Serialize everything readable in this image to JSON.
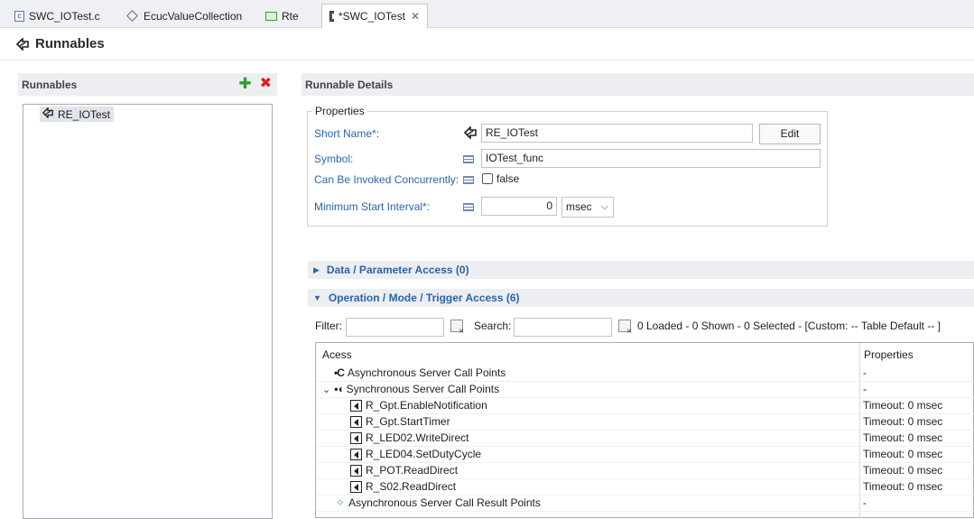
{
  "tabs": [
    {
      "label": "SWC_IOTest.c",
      "icon": "c-file-icon"
    },
    {
      "label": "EcucValueCollection",
      "icon": "ecuc-icon"
    },
    {
      "label": "Rte",
      "icon": "rte-icon"
    },
    {
      "label": "*SWC_IOTest",
      "icon": "swc-icon",
      "active": true
    }
  ],
  "page": {
    "title": "Runnables"
  },
  "left": {
    "heading": "Runnables",
    "items": [
      "RE_IOTest"
    ]
  },
  "details": {
    "heading": "Runnable Details",
    "properties_legend": "Properties",
    "short_name_label": "Short Name*:",
    "short_name_value": "RE_IOTest",
    "edit_label": "Edit",
    "symbol_label": "Symbol:",
    "symbol_value": "IOTest_func",
    "concurrent_label": "Can Be Invoked Concurrently:",
    "concurrent_value": "false",
    "min_interval_label": "Minimum Start Interval*:",
    "min_interval_value": "0",
    "min_interval_unit": "msec"
  },
  "sections": {
    "data_access": "Data / Parameter Access (0)",
    "operation_access": "Operation / Mode / Trigger Access (6)"
  },
  "filter": {
    "filter_label": "Filter:",
    "search_label": "Search:",
    "status": "0 Loaded - 0 Shown - 0 Selected -  [Custom: -- Table Default -- ]"
  },
  "table": {
    "col_access": "Acess",
    "col_properties": "Properties",
    "rows": [
      {
        "label": "Asynchronous Server Call Points",
        "prop": "-"
      },
      {
        "label": "Synchronous Server Call Points",
        "prop": "-"
      },
      {
        "label": "R_Gpt.EnableNotification",
        "prop": "Timeout: 0 msec"
      },
      {
        "label": "R_Gpt.StartTimer",
        "prop": "Timeout: 0 msec"
      },
      {
        "label": "R_LED02.WriteDirect",
        "prop": "Timeout: 0 msec"
      },
      {
        "label": "R_LED04.SetDutyCycle",
        "prop": "Timeout: 0 msec"
      },
      {
        "label": "R_POT.ReadDirect",
        "prop": "Timeout: 0 msec"
      },
      {
        "label": "R_S02.ReadDirect",
        "prop": "Timeout: 0 msec"
      },
      {
        "label": "Asynchronous Server Call Result Points",
        "prop": "-"
      }
    ]
  },
  "colors": {
    "link_blue": "#2a64b0",
    "add_green": "#2ea02e",
    "delete_red": "#e02020"
  }
}
